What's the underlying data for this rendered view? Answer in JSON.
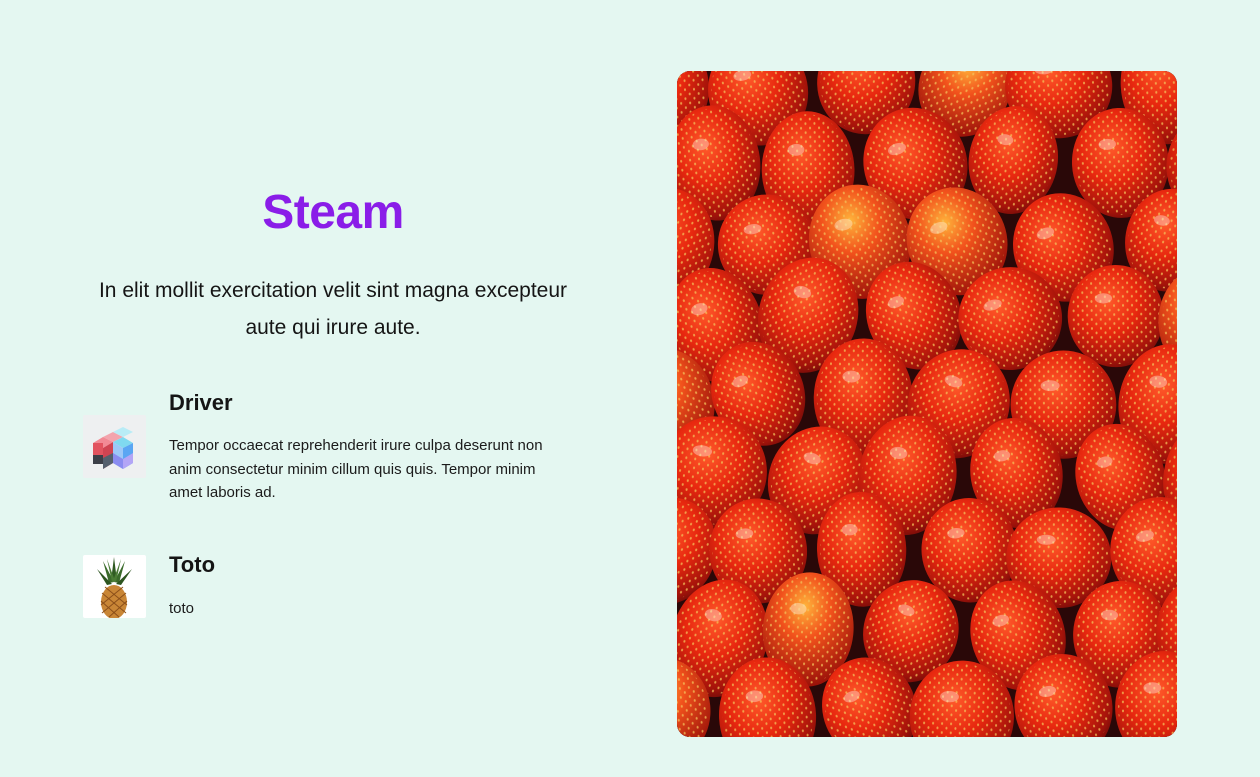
{
  "header": {
    "title": "Steam",
    "subtitle": "In elit mollit exercitation velit sint magna excepteur aute qui irure aute."
  },
  "features": [
    {
      "name": "Driver",
      "description": "Tempor occaecat reprehenderit irure culpa deserunt non anim consectetur minim cillum quis quis. Tempor minim amet laboris ad.",
      "icon": "cube-icon"
    },
    {
      "name": "Toto",
      "description": "toto",
      "icon": "pineapple-icon"
    }
  ],
  "hero": {
    "image": "strawberries-photo"
  },
  "colors": {
    "background": "#e4f7f1",
    "accent": "#8a1de8",
    "text": "#151515"
  }
}
